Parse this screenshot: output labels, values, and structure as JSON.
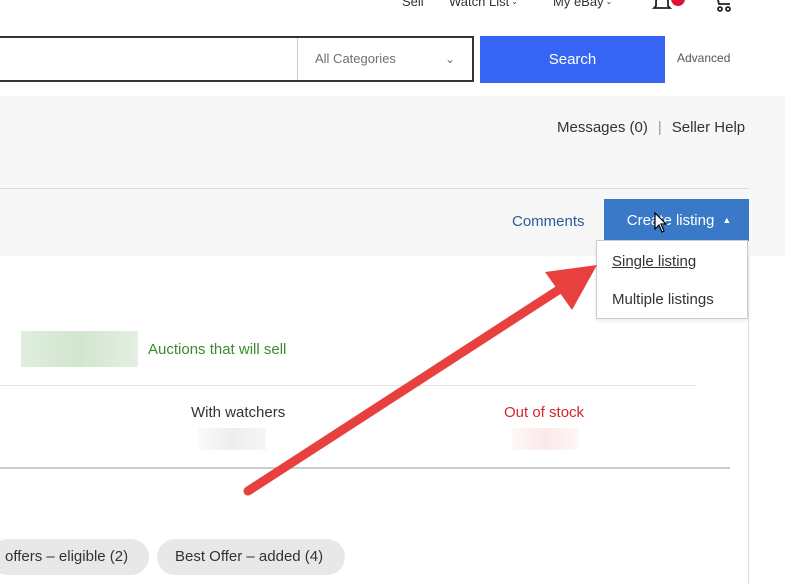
{
  "header": {
    "sell": "Sell",
    "watch_list": "Watch List",
    "my_ebay": "My eBay",
    "chevron": "⌄"
  },
  "search": {
    "input_value": "",
    "category": "All Categories",
    "button": "Search",
    "advanced": "Advanced"
  },
  "top_links": {
    "messages": "Messages (0)",
    "separator": "|",
    "seller_help": "Seller Help"
  },
  "toolbar": {
    "comments": "Comments",
    "create_listing": "Create listing"
  },
  "dropdown": {
    "options": [
      "Single listing",
      "Multiple listings"
    ]
  },
  "summary": {
    "auctions": "Auctions that will sell",
    "with_watchers": "With watchers",
    "out_of_stock": "Out of stock"
  },
  "filters": {
    "pills": [
      "offers – eligible (2)",
      "Best Offer – added (4)"
    ]
  },
  "colors": {
    "search_button": "#3665f3",
    "create_button": "#3a79c8",
    "annotation_arrow": "#e8403e",
    "auctions_text": "#3c8a2e",
    "out_of_stock_text": "#d2262d",
    "notification_dot": "#e0103a"
  },
  "icons": [
    "bell-icon",
    "cart-icon",
    "mouse-cursor-icon",
    "dropdown-caret-icon"
  ]
}
